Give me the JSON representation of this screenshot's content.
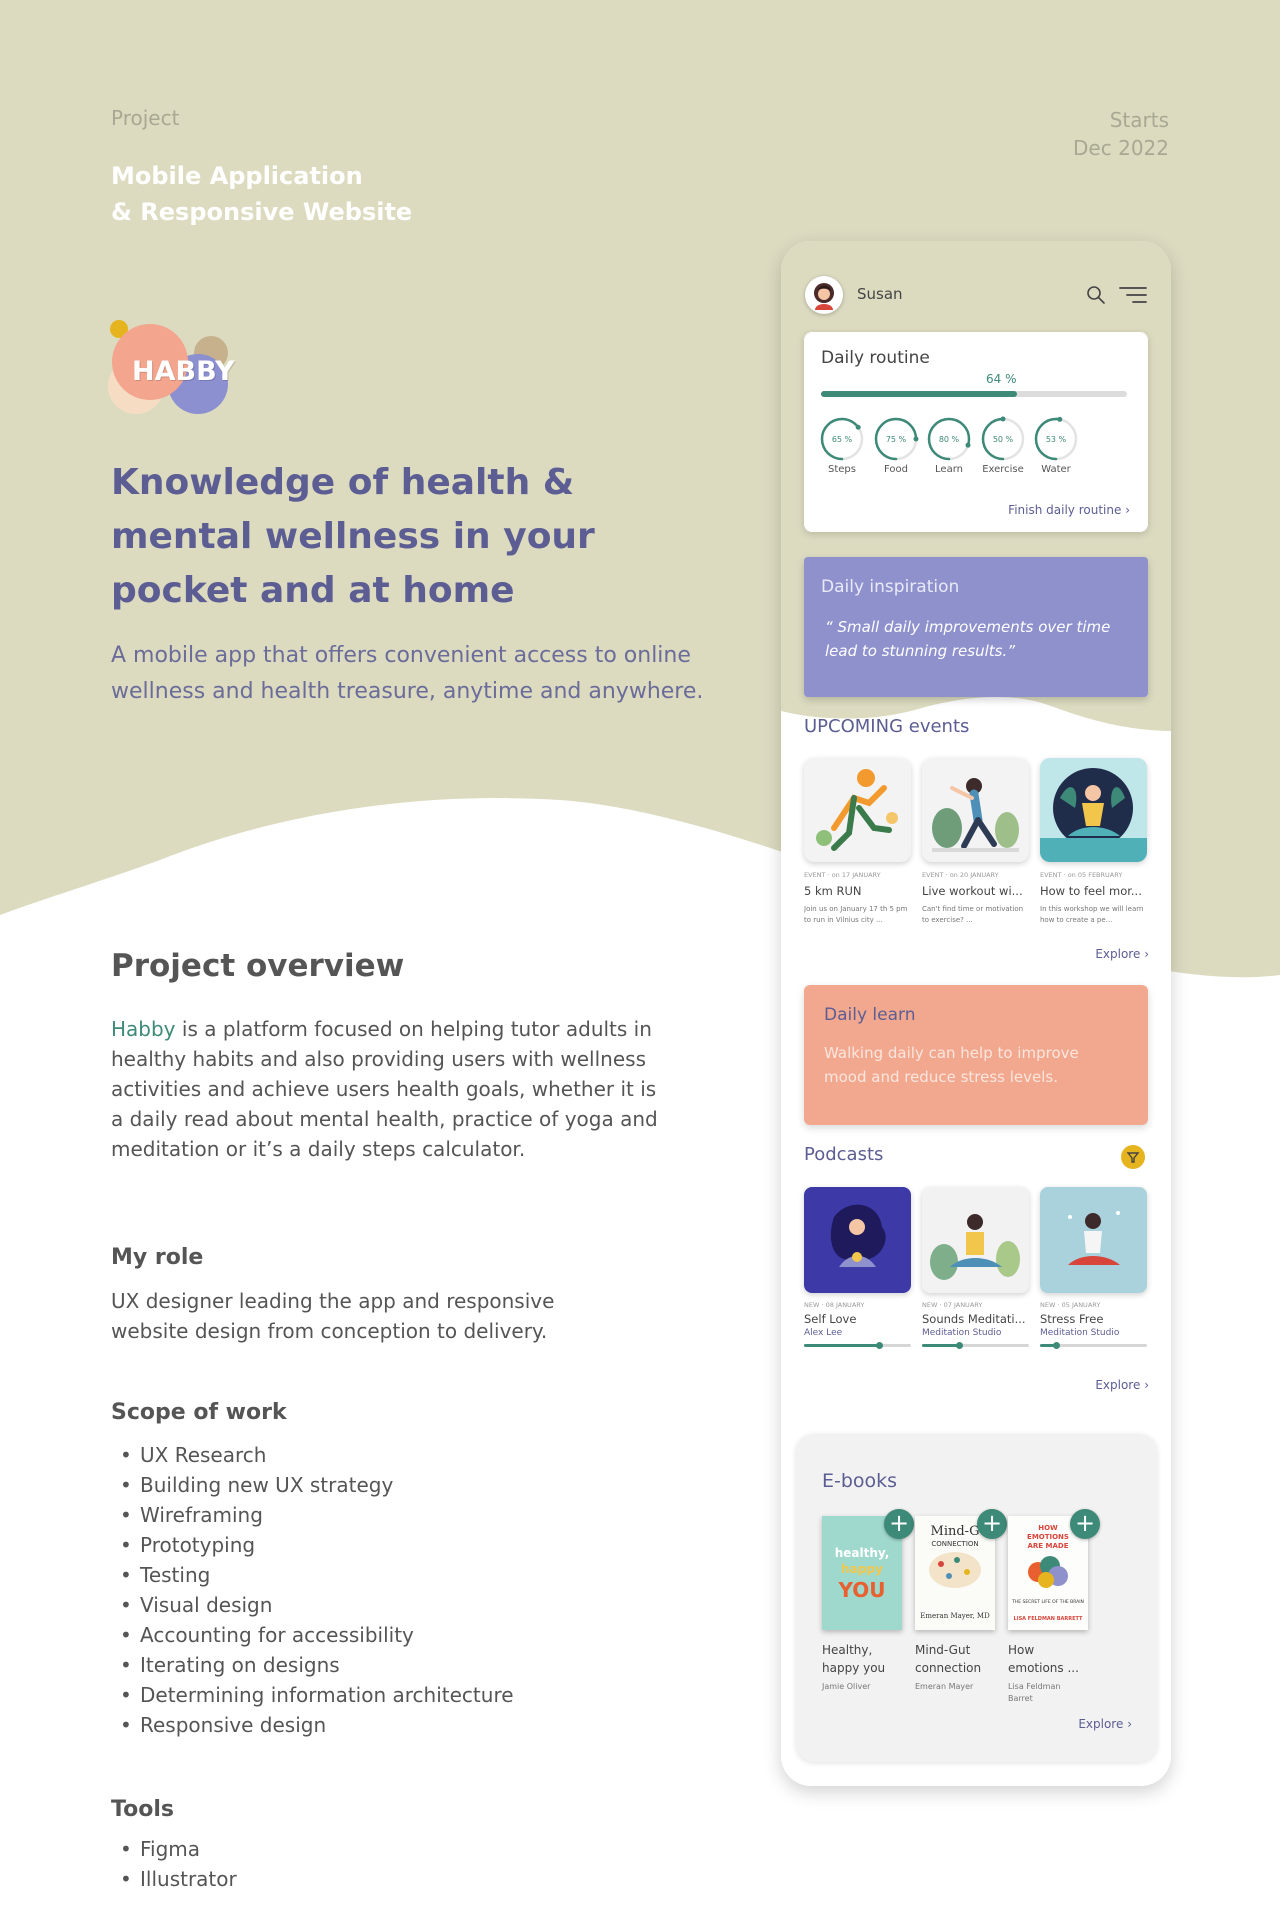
{
  "header": {
    "project_label": "Project",
    "project_line1": "Mobile Application",
    "project_line2": "& Responsive Website",
    "starts_label": "Starts",
    "starts_date": "Dec 2022"
  },
  "logo": {
    "text": "HABBY"
  },
  "hero": {
    "title": "Knowledge of health & mental wellness in your pocket and at home",
    "subtitle": "A mobile app that offers convenient access to online wellness and health treasure, anytime and anywhere."
  },
  "overview": {
    "title": "Project overview",
    "brand": "Habby",
    "text": " is a platform focused on helping tutor adults in healthy habits and also providing users with wellness activities and achieve users health goals, whether it is a daily read about mental health, practice of yoga and meditation or it’s a daily steps calculator."
  },
  "role": {
    "title": "My role",
    "text": "UX designer leading the app and responsive website design from conception to delivery."
  },
  "scope": {
    "title": "Scope of work",
    "items": [
      "UX Research",
      "Building new UX strategy",
      "Wireframing",
      "Prototyping",
      "Testing",
      "Visual design",
      "Accounting for accessibility",
      "Iterating on designs",
      "Determining information architecture",
      "Responsive design"
    ]
  },
  "tools": {
    "title": "Tools",
    "items": [
      "Figma",
      "Illustrator"
    ]
  },
  "app": {
    "user_name": "Susan",
    "routine": {
      "title": "Daily routine",
      "progress_label": "64 %",
      "progress": 0.64,
      "rings": [
        {
          "label": "Steps",
          "value_label": "65 %",
          "value": 0.65
        },
        {
          "label": "Food",
          "value_label": "75 %",
          "value": 0.75
        },
        {
          "label": "Learn",
          "value_label": "80 %",
          "value": 0.8
        },
        {
          "label": "Exercise",
          "value_label": "50 %",
          "value": 0.5
        },
        {
          "label": "Water",
          "value_label": "53 %",
          "value": 0.53
        }
      ],
      "finish_link": "Finish daily routine"
    },
    "inspiration": {
      "title": "Daily inspiration",
      "quote": "“ Small daily improvements over time lead to stunning results.”"
    },
    "events": {
      "title": "UPCOMING events",
      "items": [
        {
          "tag": "EVENT",
          "date": "on 17 JANUARY",
          "title": "5 km RUN",
          "desc": "Join us on January 17 th 5 pm to run in Vilnius city ..."
        },
        {
          "tag": "EVENT",
          "date": "on 20 JANUARY",
          "title": "Live workout wi...",
          "desc": "Can't find time or motivation to exercise? ..."
        },
        {
          "tag": "EVENT",
          "date": "on 05 FEBRUARY",
          "title": "How to feel mor...",
          "desc": "In this workshop we will learn how to create a pe..."
        }
      ],
      "explore": "Explore"
    },
    "learn": {
      "title": "Daily learn",
      "text": "Walking daily can help to improve mood and reduce stress levels."
    },
    "podcasts": {
      "title": "Podcasts",
      "items": [
        {
          "tag": "NEW",
          "date": "08 JANUARY",
          "title": "Self Love",
          "author": "Alex Lee",
          "progress": 0.7
        },
        {
          "tag": "NEW",
          "date": "07 JANUARY",
          "title": "Sounds Meditati...",
          "author": "Meditation Studio",
          "progress": 0.35
        },
        {
          "tag": "NEW",
          "date": "05 JANUARY",
          "title": "Stress Free",
          "author": "Meditation Studio",
          "progress": 0.15
        }
      ],
      "explore": "Explore"
    },
    "ebooks": {
      "title": "E-books",
      "items": [
        {
          "title": "Healthy, happy you",
          "author": "Jamie Oliver",
          "cover_lines": [
            "healthy,",
            "happy",
            "YOU"
          ]
        },
        {
          "title": "Mind-Gut connection",
          "author": "Emeran Mayer",
          "cover_lines": [
            "Mind-G",
            "CONNECTION",
            "Emeran Mayer, MD"
          ]
        },
        {
          "title": "How emotions ...",
          "author": "Lisa Feldman Barret",
          "cover_lines": [
            "HOW",
            "EMOTIONS",
            "ARE MADE",
            "THE SECRET LIFE OF THE BRAIN",
            "LISA FELDMAN BARRETT"
          ]
        }
      ],
      "explore": "Explore"
    }
  },
  "colors": {
    "beige": "#dcdbc0",
    "indigo": "#5c5d93",
    "teal": "#3e8a78",
    "lavender": "#8f91cd",
    "salmon": "#f2a88f"
  }
}
